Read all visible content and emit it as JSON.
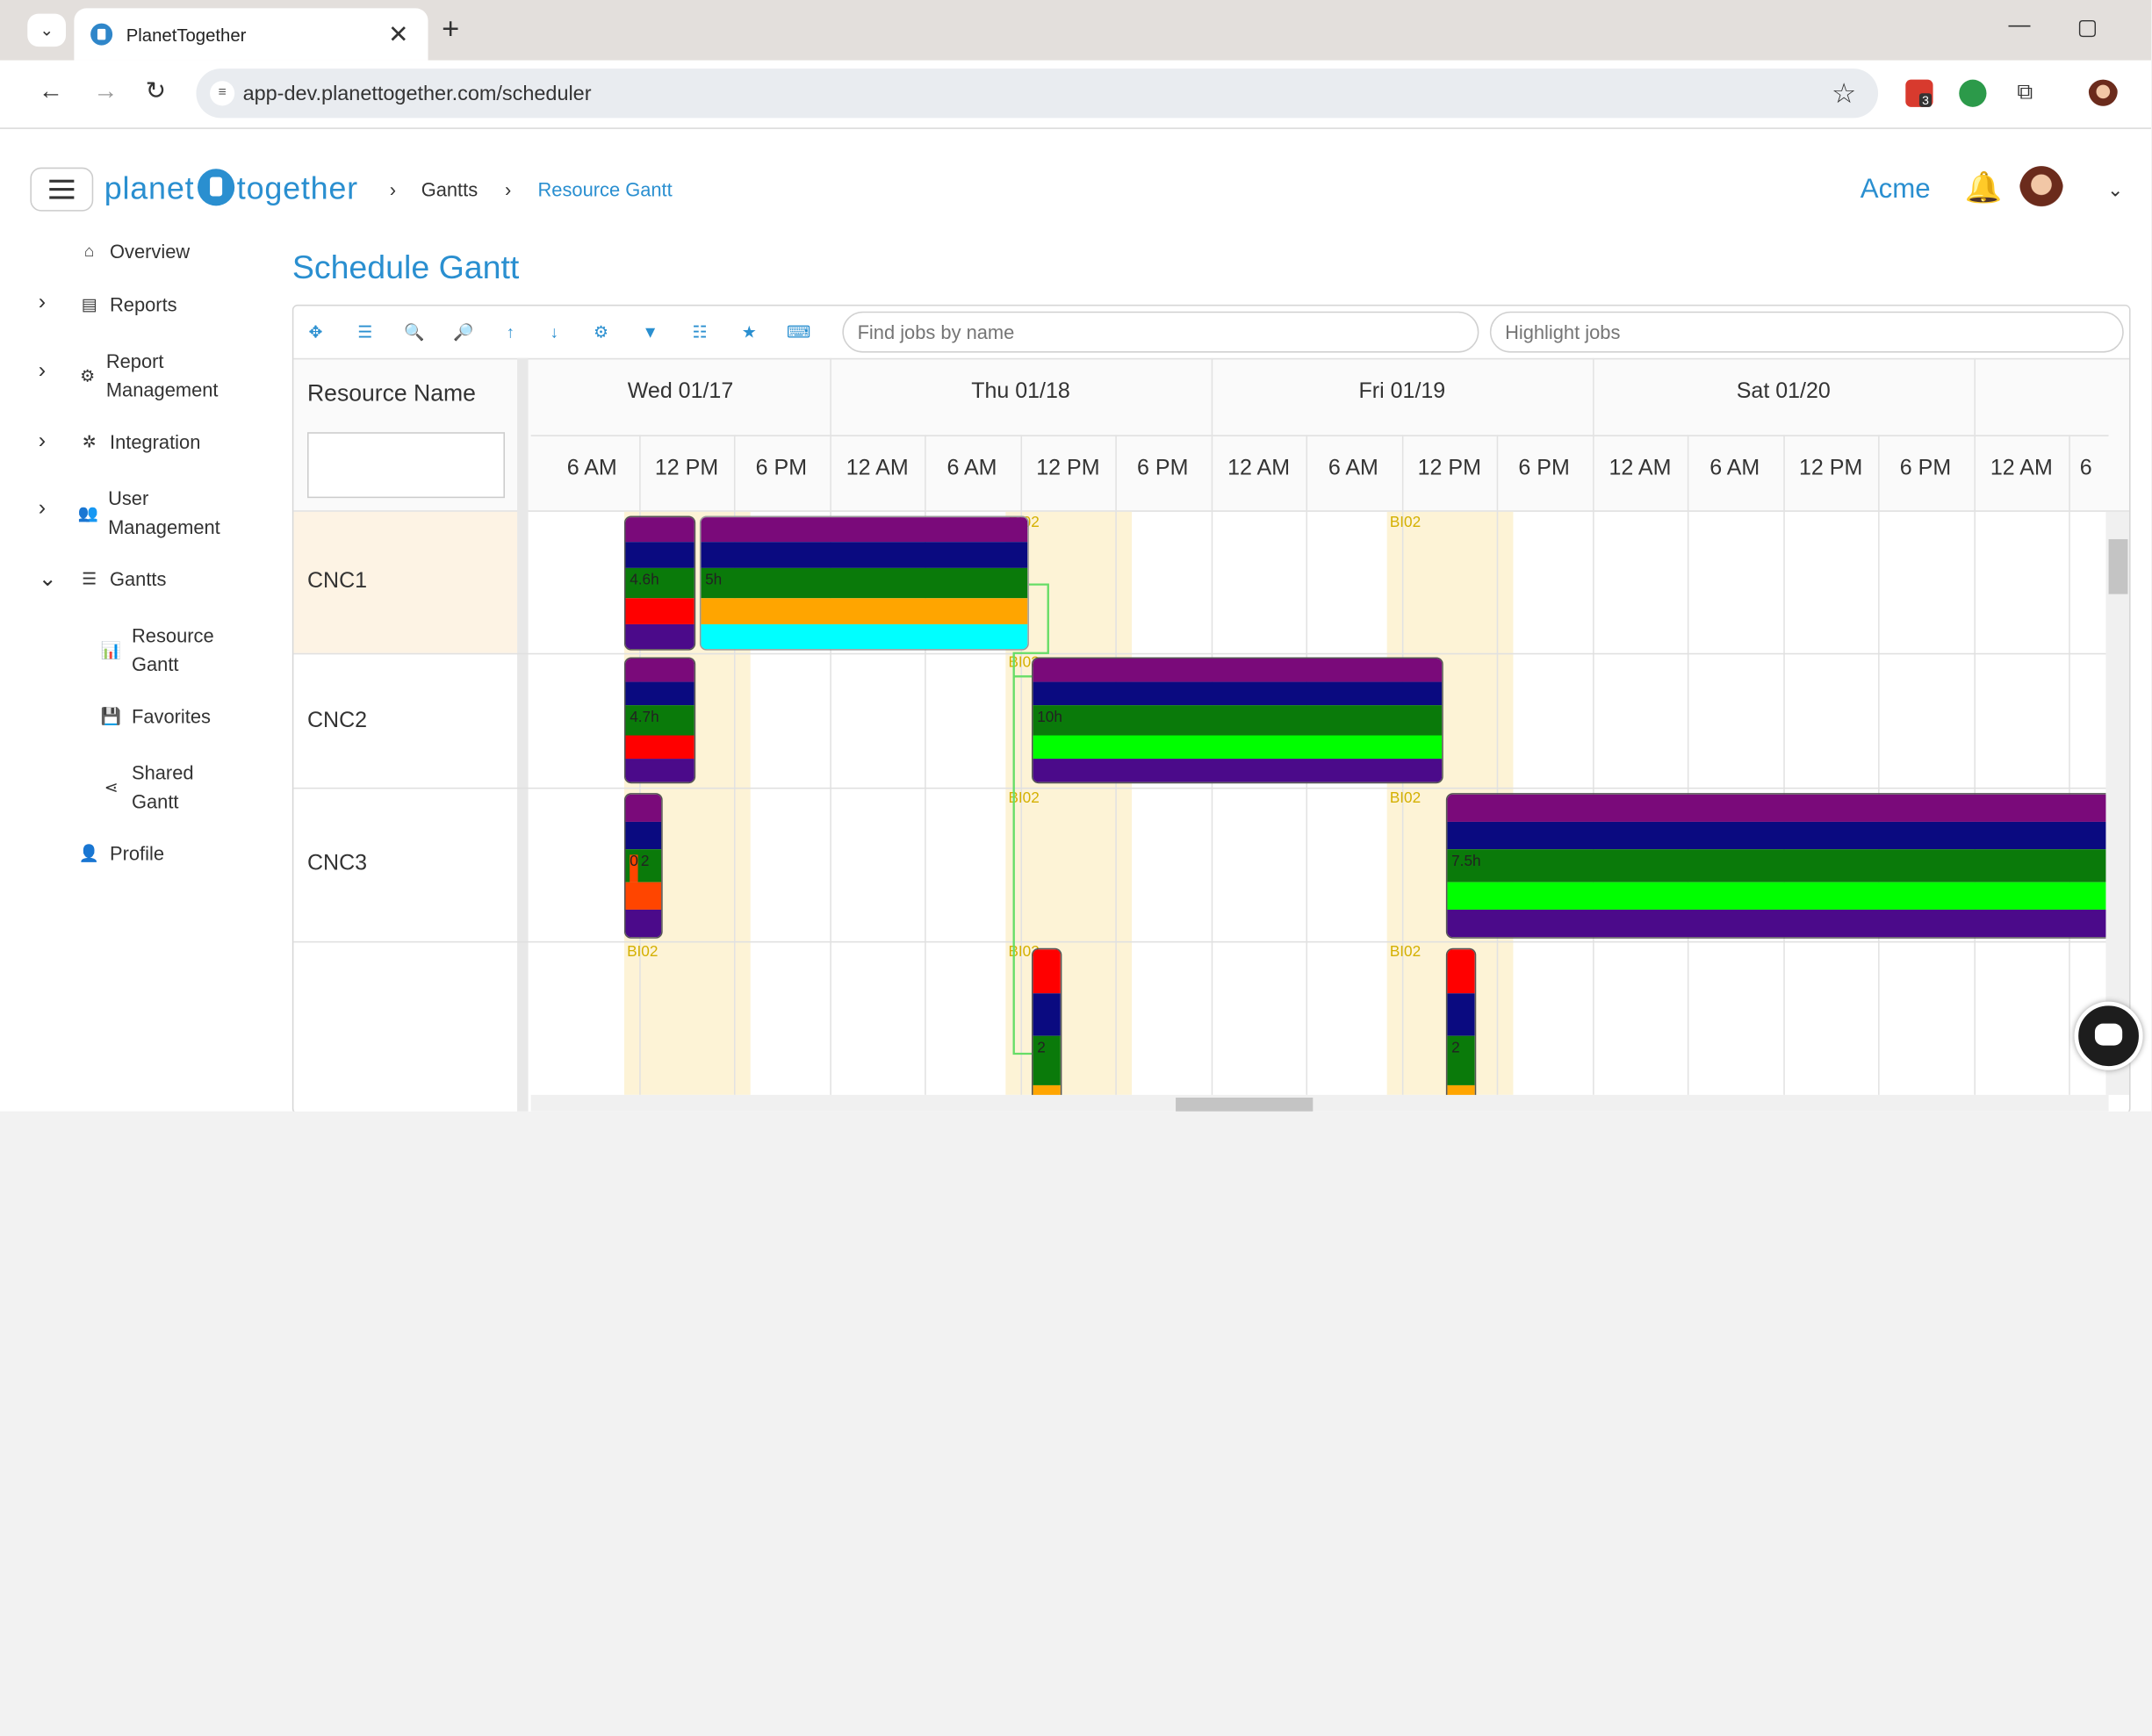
{
  "browser": {
    "tab_title": "PlanetTogether",
    "url": "app-dev.planettogether.com/scheduler",
    "ext_badge": "3"
  },
  "header": {
    "logo_left": "planet",
    "logo_right": "together",
    "breadcrumb": [
      "Gantts",
      "Resource Gantt"
    ],
    "company": "Acme"
  },
  "sidebar": {
    "items": [
      {
        "label": "Overview",
        "icon": "home-icon"
      },
      {
        "label": "Reports",
        "icon": "document-icon"
      },
      {
        "label": "Report Management",
        "icon": "gears-icon"
      },
      {
        "label": "Integration",
        "icon": "gear-icon"
      },
      {
        "label": "User Management",
        "icon": "users-icon"
      },
      {
        "label": "Gantts",
        "icon": "gantt-icon"
      },
      {
        "label": "Resource Gantt",
        "icon": "bar-chart-icon"
      },
      {
        "label": "Favorites",
        "icon": "save-icon"
      },
      {
        "label": "Shared Gantt",
        "icon": "share-icon"
      },
      {
        "label": "Profile",
        "icon": "person-icon"
      }
    ]
  },
  "page": {
    "title": "Schedule Gantt"
  },
  "toolbar": {
    "find_placeholder": "Find jobs by name",
    "highlight_placeholder": "Highlight jobs"
  },
  "gantt": {
    "resource_header": "Resource Name",
    "days": [
      "Wed 01/17",
      "Thu 01/18",
      "Fri 01/19",
      "Sat 01/20"
    ],
    "hours": [
      "6 AM",
      "12 PM",
      "6 PM",
      "12 AM",
      "6 AM",
      "12 PM",
      "6 PM",
      "12 AM",
      "6 AM",
      "12 PM",
      "6 PM",
      "12 AM",
      "6 AM",
      "12 PM",
      "6 PM",
      "12 AM",
      "6"
    ],
    "resources": [
      "CNC1",
      "CNC2",
      "CNC3",
      ""
    ],
    "shift_label": "BI02",
    "colors": {
      "purple": "#7a0a7a",
      "navy": "#0a0a80",
      "green": "#0a7a0a",
      "red": "#ff0000",
      "orange": "#ffa500",
      "cyan": "#00ffff",
      "lime": "#00ff00",
      "indigo": "#4b0a8a",
      "orangered": "#ff4500",
      "shade": "#fdf3d6",
      "brand": "#2a8fd0"
    },
    "ops": [
      {
        "label": "4.6h"
      },
      {
        "label": "5h"
      },
      {
        "label": "4.7h"
      },
      {
        "label": "10h"
      },
      {
        "label": "0",
        "label2": "2"
      },
      {
        "label": "7.5h"
      },
      {
        "label": "2"
      },
      {
        "label": "2"
      }
    ]
  }
}
